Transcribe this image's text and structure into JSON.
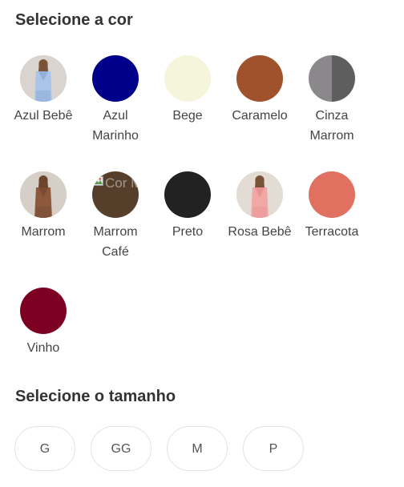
{
  "color_section": {
    "title": "Selecione a cor",
    "swatches": [
      {
        "label": "Azul Bebê",
        "kind": "photo",
        "color": "#a9c4e6"
      },
      {
        "label": "Azul Marinho",
        "kind": "solid",
        "color": "#00008b"
      },
      {
        "label": "Bege",
        "kind": "solid",
        "color": "#f5f5dc"
      },
      {
        "label": "Caramelo",
        "kind": "solid",
        "color": "#a0522d"
      },
      {
        "label": "Cinza Marrom",
        "kind": "split",
        "color": "#8a888a",
        "color2": "#5e5e5e"
      },
      {
        "label": "Marrom",
        "kind": "photo",
        "color": "#8b5a3c"
      },
      {
        "label": "Marrom Café",
        "kind": "broken-image",
        "color": "#553f2a",
        "alt": "Cor Marrom"
      },
      {
        "label": "Preto",
        "kind": "solid",
        "color": "#222222"
      },
      {
        "label": "Rosa Bebê",
        "kind": "photo",
        "color": "#f2a7a7"
      },
      {
        "label": "Terracota",
        "kind": "solid",
        "color": "#e07060"
      },
      {
        "label": "Vinho",
        "kind": "solid",
        "color": "#7d0023"
      }
    ]
  },
  "size_section": {
    "title": "Selecione o tamanho",
    "sizes": [
      "G",
      "GG",
      "M",
      "P"
    ]
  }
}
